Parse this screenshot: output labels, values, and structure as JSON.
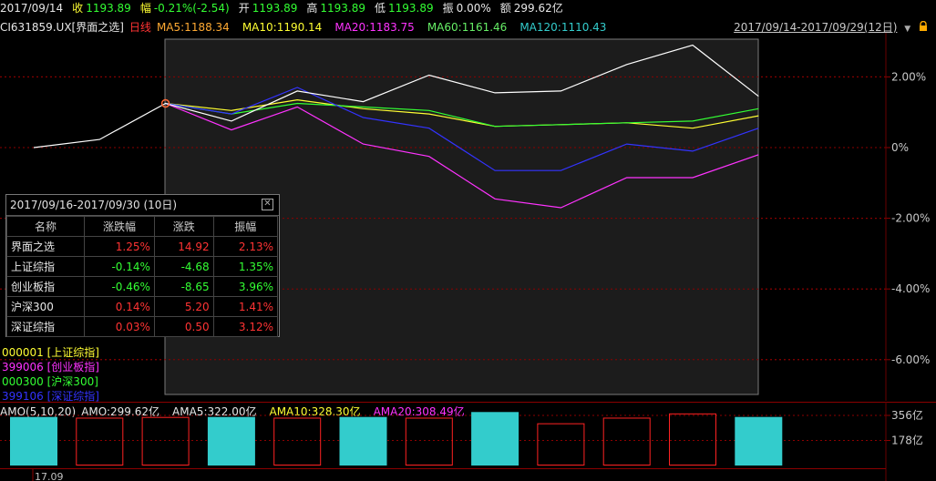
{
  "quote_bar": {
    "date": "2017/09/14",
    "close_label": "收",
    "close_value": "1193.89",
    "change_label": "幅",
    "change_value": "-0.21%(-2.54)",
    "open_label": "开",
    "open_value": "1193.89",
    "high_label": "高",
    "high_value": "1193.89",
    "low_label": "低",
    "low_value": "1193.89",
    "amplitude_label": "振",
    "amplitude_value": "0.00%",
    "amount_label": "额",
    "amount_value": "299.62亿"
  },
  "indicator_bar": {
    "symbol": "CI631859.UX",
    "name": "[界面之选]",
    "period": "日线",
    "ma5": "MA5:1188.34",
    "ma10": "MA10:1190.14",
    "ma20": "MA20:1183.75",
    "ma60": "MA60:1161.46",
    "ma120": "MA120:1110.43",
    "range": "2017/09/14-2017/09/29(12日)",
    "dropdown_icon": "chevron-down-icon",
    "lock_icon": "lock-icon"
  },
  "colors": {
    "background": "#000000",
    "grid": "#8b0000",
    "up": "#ff3333",
    "down": "#33ff33",
    "main_line": "#ffffff",
    "sh_index": "#ffff33",
    "cyb_index": "#ff33ff",
    "hs300": "#33ff33",
    "sz_index": "#3333ff",
    "volume_fill": "#33cccc",
    "volume_box": "#ff2222"
  },
  "chart_data": {
    "type": "line",
    "y_axis_labels": [
      "2.00%",
      "0%",
      "-2.00%",
      "-4.00%",
      "-6.00%"
    ],
    "y_axis_values": [
      2,
      0,
      -2,
      -4,
      -6
    ],
    "ylim": [
      -6.7,
      3.1
    ],
    "series": [
      {
        "name": "界面之选",
        "color": "#ffffff",
        "values": [
          0.0,
          0.23,
          1.25,
          0.75,
          1.6,
          1.3,
          2.05,
          1.55,
          1.6,
          2.35,
          2.9,
          1.45
        ]
      },
      {
        "name": "000001 [上证综指]",
        "color": "#ffff33",
        "values": [
          null,
          null,
          1.25,
          1.05,
          1.35,
          1.1,
          0.95,
          0.6,
          0.65,
          0.7,
          0.55,
          0.9
        ]
      },
      {
        "name": "399006 [创业板指]",
        "color": "#ff33ff",
        "values": [
          null,
          null,
          1.25,
          0.5,
          1.15,
          0.1,
          -0.25,
          -1.45,
          -1.7,
          -0.85,
          -0.85,
          -0.2
        ]
      },
      {
        "name": "000300 [沪深300]",
        "color": "#33ff33",
        "values": [
          null,
          null,
          1.25,
          0.95,
          1.25,
          1.15,
          1.05,
          0.6,
          0.65,
          0.7,
          0.75,
          1.1
        ]
      },
      {
        "name": "399106 [深证综指]",
        "color": "#3333ff",
        "values": [
          null,
          null,
          1.25,
          0.95,
          1.7,
          0.85,
          0.55,
          -0.65,
          -0.65,
          0.1,
          -0.1,
          0.55
        ]
      }
    ],
    "x_tick_labels": [
      "17.09"
    ],
    "volume": {
      "label": "AMO(5,10,20)",
      "amo": "AMO:299.62亿",
      "ama5": "AMA5:322.00亿",
      "ama10": "AMA10:328.30亿",
      "ama20": "AMA20:308.49亿",
      "y_axis_labels": [
        "356亿",
        "178亿"
      ],
      "y_axis_values": [
        356,
        178
      ],
      "ylim": [
        0,
        380
      ],
      "bars": [
        {
          "value": 345,
          "direction": "up"
        },
        {
          "value": 340,
          "direction": "down"
        },
        {
          "value": 345,
          "direction": "down"
        },
        {
          "value": 345,
          "direction": "up"
        },
        {
          "value": 340,
          "direction": "down"
        },
        {
          "value": 345,
          "direction": "up"
        },
        {
          "value": 340,
          "direction": "down"
        },
        {
          "value": 380,
          "direction": "up"
        },
        {
          "value": 300,
          "direction": "down"
        },
        {
          "value": 340,
          "direction": "down"
        },
        {
          "value": 370,
          "direction": "down"
        },
        {
          "value": 345,
          "direction": "up"
        }
      ]
    }
  },
  "comparison_popup": {
    "title": "2017/09/16-2017/09/30 (10日)",
    "close_icon": "close-icon",
    "headers": [
      "名称",
      "涨跌幅",
      "涨跌",
      "振幅"
    ],
    "rows": [
      {
        "name": "界面之选",
        "pct": "1.25%",
        "chg": "14.92",
        "amp": "2.13%",
        "dir": "up"
      },
      {
        "name": "上证综指",
        "pct": "-0.14%",
        "chg": "-4.68",
        "amp": "1.35%",
        "dir": "down"
      },
      {
        "name": "创业板指",
        "pct": "-0.46%",
        "chg": "-8.65",
        "amp": "3.96%",
        "dir": "down"
      },
      {
        "name": "沪深300",
        "pct": "0.14%",
        "chg": "5.20",
        "amp": "1.41%",
        "dir": "up"
      },
      {
        "name": "深证综指",
        "pct": "0.03%",
        "chg": "0.50",
        "amp": "3.12%",
        "dir": "up"
      }
    ]
  },
  "legend": [
    {
      "text": "000001 [上证综指]",
      "color": "#ffff33"
    },
    {
      "text": "399006 [创业板指]",
      "color": "#ff33ff"
    },
    {
      "text": "000300 [沪深300]",
      "color": "#33ff33"
    },
    {
      "text": "399106 [深证综指]",
      "color": "#3333ff"
    }
  ]
}
